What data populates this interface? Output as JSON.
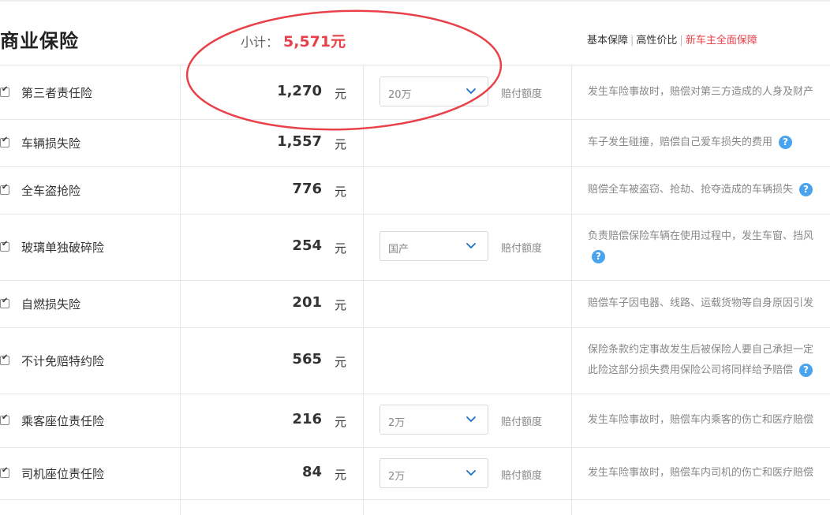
{
  "header": {
    "title": "商业保险",
    "subtotal_label": "小计：",
    "subtotal_value": "5,571元",
    "plans": [
      "基本保障",
      "高性价比",
      "新车主全面保障"
    ]
  },
  "colors": {
    "accent": "#e8414a",
    "help": "#4aa3ef",
    "annotation": "#e8414a"
  },
  "coverage_label": "赔付额度",
  "rows": [
    {
      "name": "第三者责任险",
      "price": "1,270",
      "unit": "元",
      "option": "20万",
      "desc": [
        "发生车险事故时，赔偿对第三方造成的人身及财产"
      ],
      "help": false
    },
    {
      "name": "车辆损失险",
      "price": "1,557",
      "unit": "元",
      "option": "",
      "desc": [
        "车子发生碰撞，赔偿自己爱车损失的费用"
      ],
      "help": true
    },
    {
      "name": "全车盗抢险",
      "price": "776",
      "unit": "元",
      "option": "",
      "desc": [
        "赔偿全车被盗窃、抢劫、抢夺造成的车辆损失"
      ],
      "help": true
    },
    {
      "name": "玻璃单独破碎险",
      "price": "254",
      "unit": "元",
      "option": "国产",
      "desc": [
        "负责赔偿保险车辆在使用过程中，发生车窗、挡风",
        ""
      ],
      "help": true
    },
    {
      "name": "自燃损失险",
      "price": "201",
      "unit": "元",
      "option": "",
      "desc": [
        "赔偿车子因电器、线路、运载货物等自身原因引发"
      ],
      "help": false
    },
    {
      "name": "不计免赔特约险",
      "price": "565",
      "unit": "元",
      "option": "",
      "desc": [
        "保险条款约定事故发生后被保险人要自己承担一定",
        "此险这部分损失费用保险公司将同样给予赔偿"
      ],
      "help": true
    },
    {
      "name": "乘客座位责任险",
      "price": "216",
      "unit": "元",
      "option": "2万",
      "desc": [
        "发生车险事故时，赔偿车内乘客的伤亡和医疗赔偿"
      ],
      "help": false
    },
    {
      "name": "司机座位责任险",
      "price": "84",
      "unit": "元",
      "option": "2万",
      "desc": [
        "发生车险事故时，赔偿车内司机的伤亡和医疗赔偿"
      ],
      "help": false
    }
  ]
}
